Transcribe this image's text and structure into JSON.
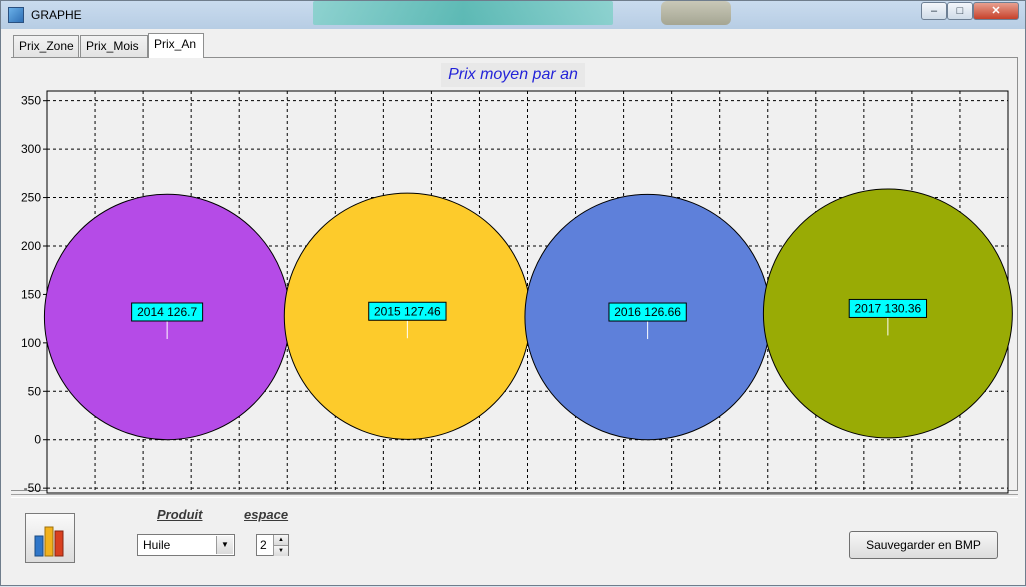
{
  "window": {
    "title": "GRAPHE",
    "minimize_glyph": "–",
    "maximize_glyph": "□",
    "close_glyph": "✕"
  },
  "tabs": [
    {
      "label": "Prix_Zone"
    },
    {
      "label": "Prix_Mois"
    },
    {
      "label": "Prix_An"
    }
  ],
  "active_tab": "Prix_An",
  "chart_data": {
    "type": "bubble",
    "title": "Prix moyen par an",
    "xlabel": "",
    "ylabel": "",
    "ylim": [
      -55,
      360
    ],
    "yticks": [
      -50,
      0,
      50,
      100,
      150,
      200,
      250,
      300,
      350
    ],
    "grid": true,
    "points": [
      {
        "year": "2014",
        "value": 126.7,
        "label": "2014 126.7",
        "color": "#b54be7"
      },
      {
        "year": "2015",
        "value": 127.46,
        "label": "2015 127.46",
        "color": "#fdcb2b"
      },
      {
        "year": "2016",
        "value": 126.66,
        "label": "2016 126.66",
        "color": "#5e80da"
      },
      {
        "year": "2017",
        "value": 130.36,
        "label": "2017 130.36",
        "color": "#99ab05"
      }
    ],
    "label_bg": "#00ffff"
  },
  "controls": {
    "produit_label": "Produit",
    "produit_value": "Huile",
    "espace_label": "espace",
    "espace_value": "2",
    "save_button": "Sauvegarder en BMP"
  }
}
